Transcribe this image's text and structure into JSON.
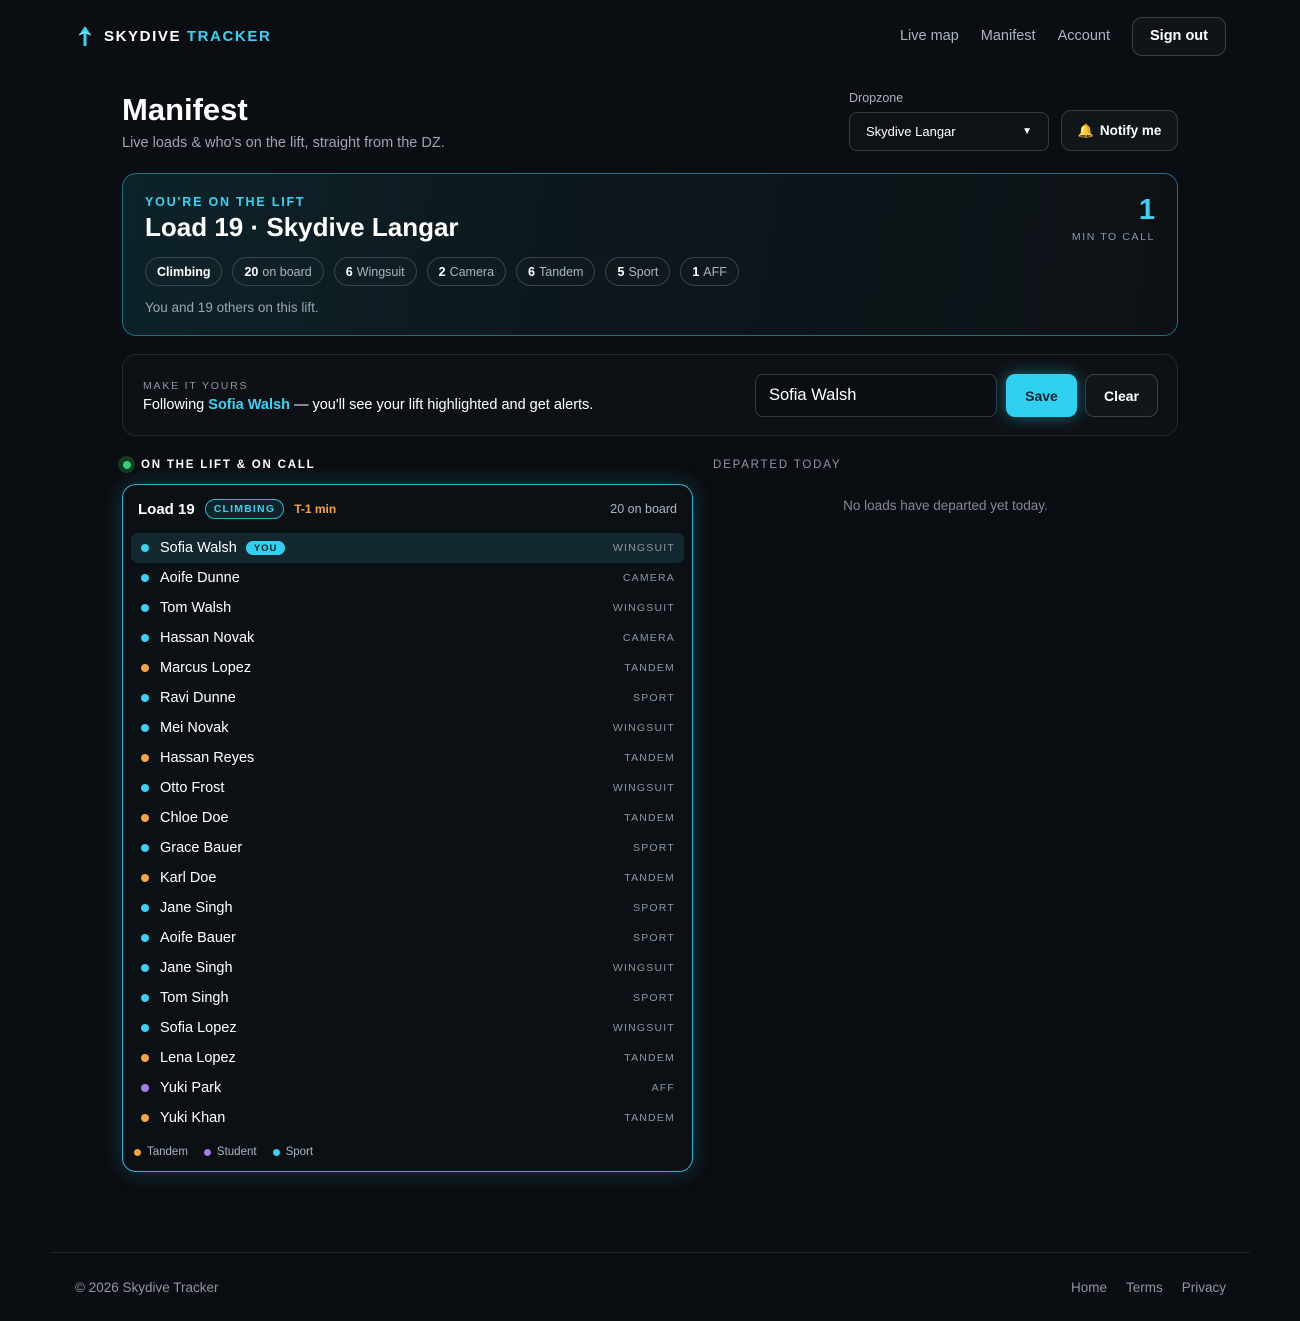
{
  "brand": {
    "name_a": "SKYDIVE",
    "name_b": "TRACKER",
    "logo_icon": "plane-up-icon",
    "accent": "#38d3f5"
  },
  "nav": {
    "items": [
      "Live map",
      "Manifest",
      "Account"
    ],
    "sign_out": "Sign out"
  },
  "page": {
    "title": "Manifest",
    "subtitle": "Live loads & who's on the lift, straight from the DZ."
  },
  "dropzone": {
    "label": "Dropzone",
    "selected": "Skydive Langar",
    "notify_label": "Notify me",
    "notify_icon": "bell-icon"
  },
  "lift": {
    "eyebrow": "YOU'RE ON THE LIFT",
    "title": "Load 19 · Skydive Langar",
    "status": "Climbing",
    "chips": [
      {
        "count": "20",
        "label": "on board"
      },
      {
        "count": "6",
        "label": "Wingsuit"
      },
      {
        "count": "2",
        "label": "Camera"
      },
      {
        "count": "6",
        "label": "Tandem"
      },
      {
        "count": "5",
        "label": "Sport"
      },
      {
        "count": "1",
        "label": "AFF"
      }
    ],
    "note": "You and 19 others on this lift.",
    "call_number": "1",
    "call_label": "MIN TO CALL"
  },
  "follow": {
    "eyebrow": "MAKE IT YOURS",
    "text_pre": "Following",
    "name": "Sofia Walsh",
    "text_post": "— you'll see your lift highlighted and get alerts.",
    "input_value": "Sofia Walsh",
    "save_label": "Save",
    "clear_label": "Clear"
  },
  "sections": {
    "live": "ON THE LIFT & ON CALL",
    "departed": "DEPARTED TODAY",
    "departed_empty": "No loads have departed yet today."
  },
  "load": {
    "name": "Load 19",
    "badge": "CLIMBING",
    "tminus": "T-1 min",
    "count": "20 on board",
    "you_badge": "YOU",
    "jumpers": [
      {
        "name": "Sofia Walsh",
        "type": "WINGSUIT",
        "color": "#38d3f5",
        "me": true
      },
      {
        "name": "Aoife Dunne",
        "type": "CAMERA",
        "color": "#38d3f5"
      },
      {
        "name": "Tom Walsh",
        "type": "WINGSUIT",
        "color": "#38d3f5"
      },
      {
        "name": "Hassan Novak",
        "type": "CAMERA",
        "color": "#38d3f5"
      },
      {
        "name": "Marcus Lopez",
        "type": "TANDEM",
        "color": "#f5a640"
      },
      {
        "name": "Ravi Dunne",
        "type": "SPORT",
        "color": "#38d3f5"
      },
      {
        "name": "Mei Novak",
        "type": "WINGSUIT",
        "color": "#38d3f5"
      },
      {
        "name": "Hassan Reyes",
        "type": "TANDEM",
        "color": "#f5a640"
      },
      {
        "name": "Otto Frost",
        "type": "WINGSUIT",
        "color": "#38d3f5"
      },
      {
        "name": "Chloe Doe",
        "type": "TANDEM",
        "color": "#f5a640"
      },
      {
        "name": "Grace Bauer",
        "type": "SPORT",
        "color": "#38d3f5"
      },
      {
        "name": "Karl Doe",
        "type": "TANDEM",
        "color": "#f5a640"
      },
      {
        "name": "Jane Singh",
        "type": "SPORT",
        "color": "#38d3f5"
      },
      {
        "name": "Aoife Bauer",
        "type": "SPORT",
        "color": "#38d3f5"
      },
      {
        "name": "Jane Singh",
        "type": "WINGSUIT",
        "color": "#38d3f5"
      },
      {
        "name": "Tom Singh",
        "type": "SPORT",
        "color": "#38d3f5"
      },
      {
        "name": "Sofia Lopez",
        "type": "WINGSUIT",
        "color": "#38d3f5"
      },
      {
        "name": "Lena Lopez",
        "type": "TANDEM",
        "color": "#f5a640"
      },
      {
        "name": "Yuki Park",
        "type": "AFF",
        "color": "#a77bf0"
      },
      {
        "name": "Yuki Khan",
        "type": "TANDEM",
        "color": "#f5a640"
      }
    ],
    "legend": [
      {
        "label": "Tandem",
        "color": "#f5a640"
      },
      {
        "label": "Student",
        "color": "#a77bf0"
      },
      {
        "label": "Sport",
        "color": "#38d3f5"
      }
    ]
  },
  "footer": {
    "copyright": "© 2026 Skydive Tracker",
    "links": [
      "Home",
      "Terms",
      "Privacy"
    ]
  }
}
